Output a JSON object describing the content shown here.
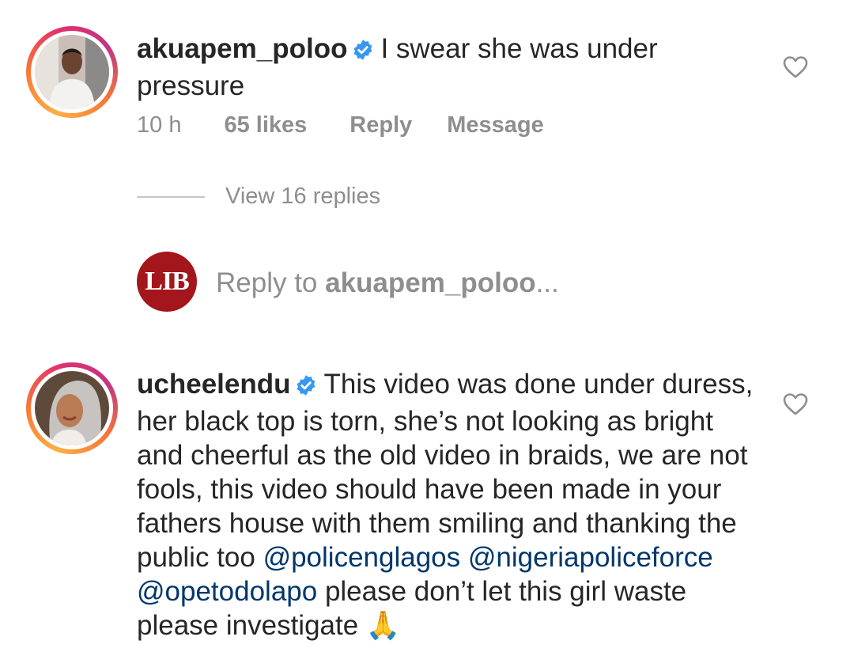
{
  "comments": [
    {
      "username": "akuapem_poloo",
      "text": "I swear she was under pressure",
      "time": "10 h",
      "likes": "65 likes",
      "reply": "Reply",
      "message": "Message",
      "view_replies": "View 16 replies"
    },
    {
      "username": "ucheelendu",
      "text_part1": "This video was done under duress, her black top is torn, she’s not looking as bright and cheerful as the old video in braids, we are not fools, this video should have been made in your fathers house with them smiling and thanking the public too ",
      "mention1": "@policenglagos",
      "mention2": "@nigeriapoliceforce",
      "mention3": "@opetodolapo",
      "text_part2": " please don’t let this girl waste please investigate ",
      "emoji": "🙏"
    }
  ],
  "reply_box": {
    "avatar_text": "LIB",
    "prefix": "Reply to ",
    "target": "akuapem_poloo",
    "suffix": "..."
  },
  "colors": {
    "verified": "#3897f0",
    "mention": "#00376b",
    "meta": "#8e8e8e",
    "lib": "#a3161b"
  }
}
